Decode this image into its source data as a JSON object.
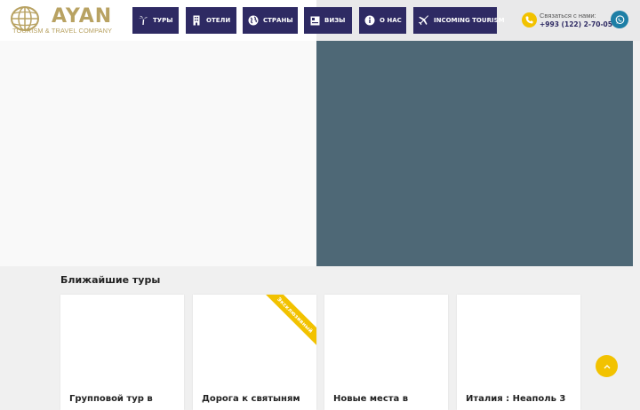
{
  "brand": {
    "name": "AYAN",
    "tagline": "TOURISM & TRAVEL COMPANY",
    "color": "#b8a262"
  },
  "nav": {
    "items": [
      {
        "label": "ТУРЫ",
        "icon": "palm-tree-icon"
      },
      {
        "label": "ОТЕЛИ",
        "icon": "building-icon"
      },
      {
        "label": "СТРАНЫ",
        "icon": "globe-icon"
      },
      {
        "label": "ВИЗЫ",
        "icon": "passport-icon"
      },
      {
        "label": "О НАС",
        "icon": "info-icon"
      },
      {
        "label": "INCOMING TOURISM",
        "icon": "airplane-icon"
      }
    ],
    "color": "#2e2a63"
  },
  "contact": {
    "label": "Связаться с нами:",
    "phone": "+993 (122) 2-70-05",
    "phone_icon": "phone-icon",
    "whatsapp_icon": "whatsapp-icon"
  },
  "tours": {
    "section_title": "Ближайшие туры",
    "cards": [
      {
        "title": "Групповой тур в",
        "ribbon": ""
      },
      {
        "title": "Дорога к святыням",
        "ribbon": "Эксклюзивный"
      },
      {
        "title": "Новые места в",
        "ribbon": ""
      },
      {
        "title": "Италия : Неаполь 3",
        "ribbon": ""
      }
    ]
  },
  "scroll_top_icon": "chevron-up-icon",
  "colors": {
    "accent": "#f2c200",
    "hero_right": "#4e6876"
  }
}
